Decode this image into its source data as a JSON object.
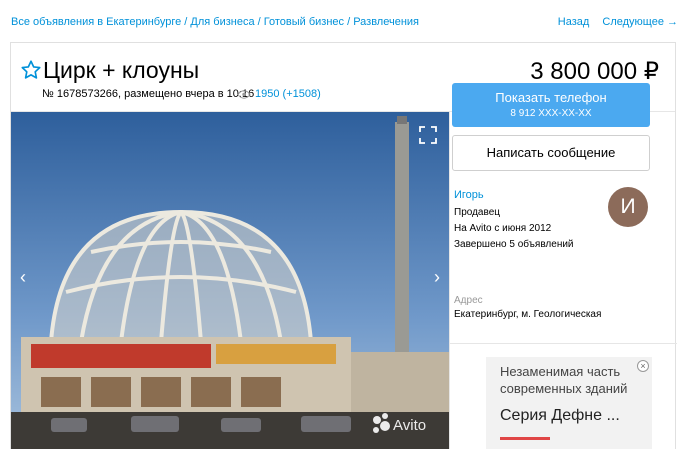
{
  "breadcrumb": {
    "items": [
      "Все объявления в Екатеринбурге",
      "Для бизнеса",
      "Готовый бизнес",
      "Развлечения"
    ],
    "separator": " / "
  },
  "nav": {
    "back": "Назад",
    "next": "Следующее →"
  },
  "listing": {
    "title": "Цирк + клоуны",
    "price": "3 800 000 ₽",
    "meta": "№ 1678573266, размещено вчера в 10:16",
    "views": "1950 (+1508)"
  },
  "actions": {
    "phone_label": "Показать телефон",
    "phone_masked": "8 912 XXX-XX-XX",
    "message_label": "Написать сообщение"
  },
  "seller": {
    "name": "Игорь",
    "role": "Продавец",
    "since": "На Avito с июня 2012",
    "completed": "Завершено 5 объявлений",
    "avatar_letter": "И",
    "avatar_color": "#8c6b5a"
  },
  "address": {
    "label": "Адрес",
    "value": "Екатеринбург, м. Геологическая"
  },
  "photo": {
    "watermark": "Avito"
  },
  "ad": {
    "line1": "Незаменимая часть современных зданий",
    "line2": "Серия Дефне ...",
    "close": "×"
  },
  "colors": {
    "link": "#0091d9",
    "primary_button": "#4ba9f0"
  }
}
